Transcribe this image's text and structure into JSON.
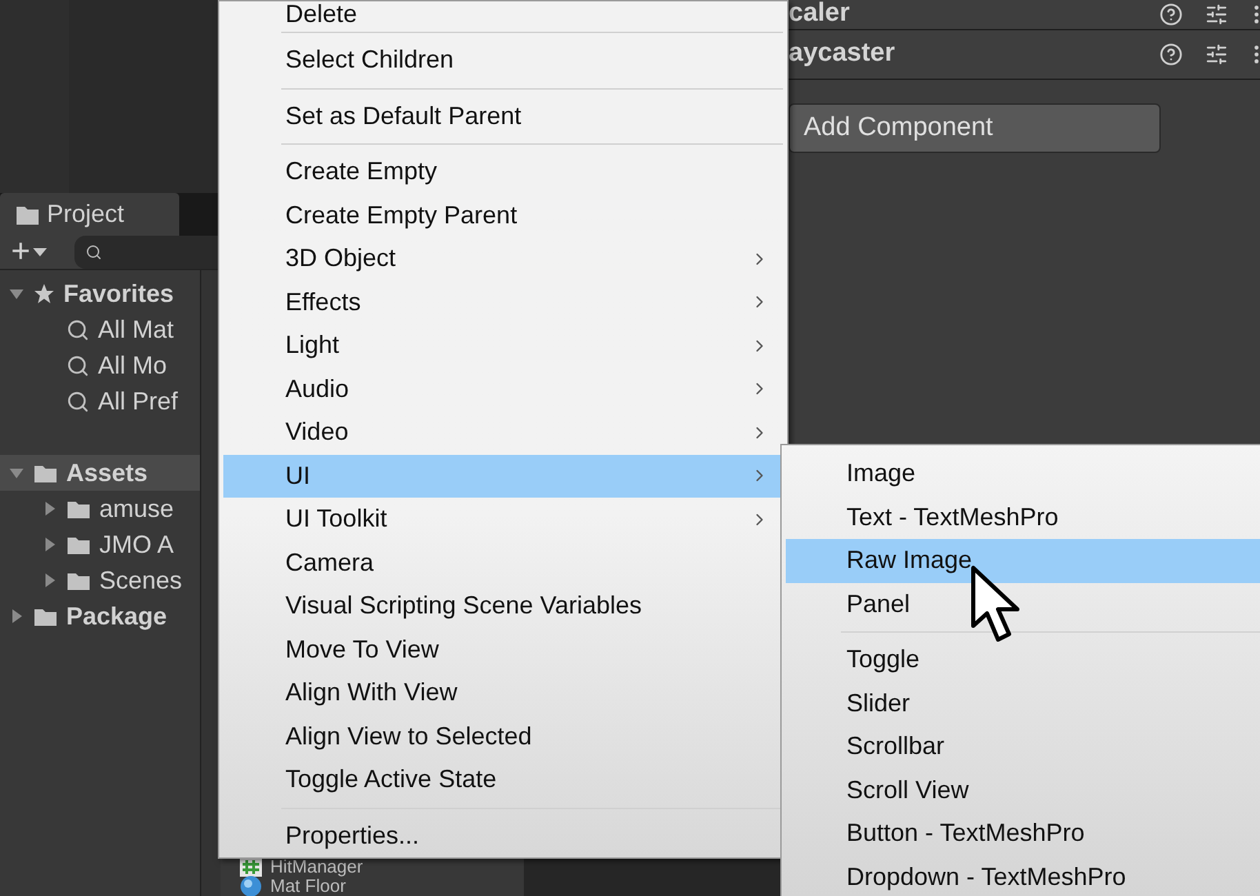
{
  "inspector": {
    "components": [
      {
        "title": "caler"
      },
      {
        "title": "aycaster"
      }
    ],
    "add_component_button": "Add Component"
  },
  "project": {
    "tab": "Project",
    "add_button": "+",
    "tree": [
      {
        "label": "Favorites",
        "kind": "favorites",
        "expanded": true,
        "selected": false,
        "children": [
          {
            "label": "All Mat",
            "kind": "search",
            "selected": false
          },
          {
            "label": "All Mo",
            "kind": "search",
            "selected": false
          },
          {
            "label": "All Pref",
            "kind": "search",
            "selected": false
          }
        ]
      },
      {
        "label": "Assets",
        "kind": "folder",
        "expanded": true,
        "selected": true,
        "children": [
          {
            "label": "amuse",
            "kind": "folder",
            "expanded": false,
            "selected": false
          },
          {
            "label": "JMO A",
            "kind": "folder",
            "expanded": false,
            "selected": false
          },
          {
            "label": "Scenes",
            "kind": "folder",
            "expanded": false,
            "selected": false
          }
        ]
      },
      {
        "label": "Package",
        "kind": "folder",
        "expanded": false,
        "selected": false
      }
    ]
  },
  "hierarchy_items": [
    {
      "label": "HitManager",
      "kind": "script"
    },
    {
      "label": "Mat Floor",
      "kind": "material"
    }
  ],
  "context_menu": {
    "items": [
      {
        "kind": "item",
        "label": "Delete",
        "has_submenu": false,
        "selected": false
      },
      {
        "kind": "separator"
      },
      {
        "kind": "item",
        "label": "Select Children",
        "has_submenu": false,
        "selected": false
      },
      {
        "kind": "separator"
      },
      {
        "kind": "item",
        "label": "Set as Default Parent",
        "has_submenu": false,
        "selected": false
      },
      {
        "kind": "separator"
      },
      {
        "kind": "item",
        "label": "Create Empty",
        "has_submenu": false,
        "selected": false
      },
      {
        "kind": "item",
        "label": "Create Empty Parent",
        "has_submenu": false,
        "selected": false
      },
      {
        "kind": "item",
        "label": "3D Object",
        "has_submenu": true,
        "selected": false
      },
      {
        "kind": "item",
        "label": "Effects",
        "has_submenu": true,
        "selected": false
      },
      {
        "kind": "item",
        "label": "Light",
        "has_submenu": true,
        "selected": false
      },
      {
        "kind": "item",
        "label": "Audio",
        "has_submenu": true,
        "selected": false
      },
      {
        "kind": "item",
        "label": "Video",
        "has_submenu": true,
        "selected": false
      },
      {
        "kind": "item",
        "label": "UI",
        "has_submenu": true,
        "selected": true
      },
      {
        "kind": "item",
        "label": "UI Toolkit",
        "has_submenu": true,
        "selected": false
      },
      {
        "kind": "item",
        "label": "Camera",
        "has_submenu": false,
        "selected": false
      },
      {
        "kind": "item",
        "label": "Visual Scripting Scene Variables",
        "has_submenu": false,
        "selected": false
      },
      {
        "kind": "item",
        "label": "Move To View",
        "has_submenu": false,
        "selected": false
      },
      {
        "kind": "item",
        "label": "Align With View",
        "has_submenu": false,
        "selected": false
      },
      {
        "kind": "item",
        "label": "Align View to Selected",
        "has_submenu": false,
        "selected": false
      },
      {
        "kind": "item",
        "label": "Toggle Active State",
        "has_submenu": false,
        "selected": false
      },
      {
        "kind": "separator"
      },
      {
        "kind": "item",
        "label": "Properties...",
        "has_submenu": false,
        "selected": false
      }
    ]
  },
  "submenu": {
    "items": [
      {
        "kind": "item",
        "label": "Image",
        "selected": false
      },
      {
        "kind": "item",
        "label": "Text - TextMeshPro",
        "selected": false
      },
      {
        "kind": "item",
        "label": "Raw Image",
        "selected": true
      },
      {
        "kind": "item",
        "label": "Panel",
        "selected": false
      },
      {
        "kind": "separator"
      },
      {
        "kind": "item",
        "label": "Toggle",
        "selected": false
      },
      {
        "kind": "item",
        "label": "Slider",
        "selected": false
      },
      {
        "kind": "item",
        "label": "Scrollbar",
        "selected": false
      },
      {
        "kind": "item",
        "label": "Scroll View",
        "selected": false
      },
      {
        "kind": "item",
        "label": "Button - TextMeshPro",
        "selected": false
      },
      {
        "kind": "item",
        "label": "Dropdown - TextMeshPro",
        "selected": false
      }
    ]
  }
}
